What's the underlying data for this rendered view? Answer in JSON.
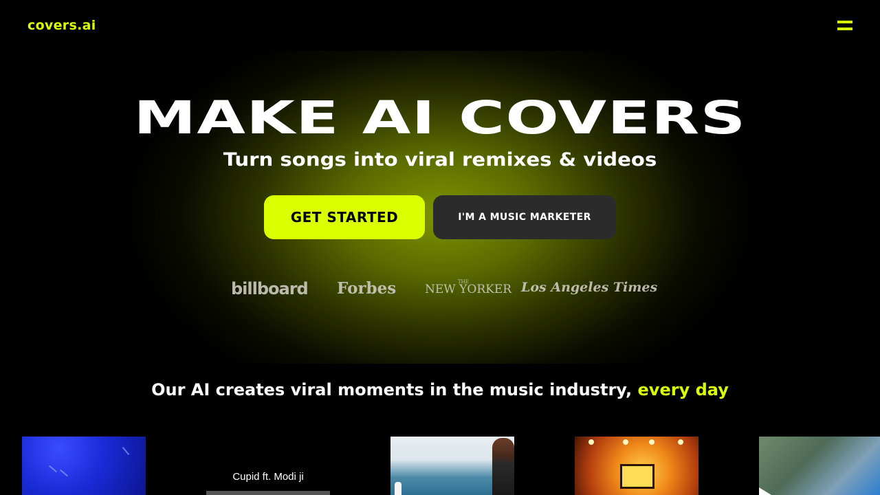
{
  "header": {
    "logo": "covers.ai",
    "menu_icon": "hamburger-menu-icon"
  },
  "hero": {
    "title": "MAKE AI COVERS",
    "subtitle": "Turn songs into viral remixes & videos",
    "primary_button": "GET STARTED",
    "secondary_button": "I'M A MUSIC MARKETER",
    "press": [
      "billboard",
      "Forbes",
      "NEW YORKER",
      "Los Angeles Times"
    ],
    "press_newyorker_prefix": "THE"
  },
  "tagline": {
    "text": "Our AI creates viral moments in the music industry,",
    "highlight": "every day"
  },
  "thumbnails": [
    {
      "caption": ""
    },
    {
      "caption": "Cupid ft. Modi ji"
    },
    {
      "caption": ""
    },
    {
      "caption": ""
    },
    {
      "caption": ""
    }
  ],
  "colors": {
    "accent": "#d9ff00",
    "background": "#000000",
    "secondary_button": "#2b2b2b"
  }
}
